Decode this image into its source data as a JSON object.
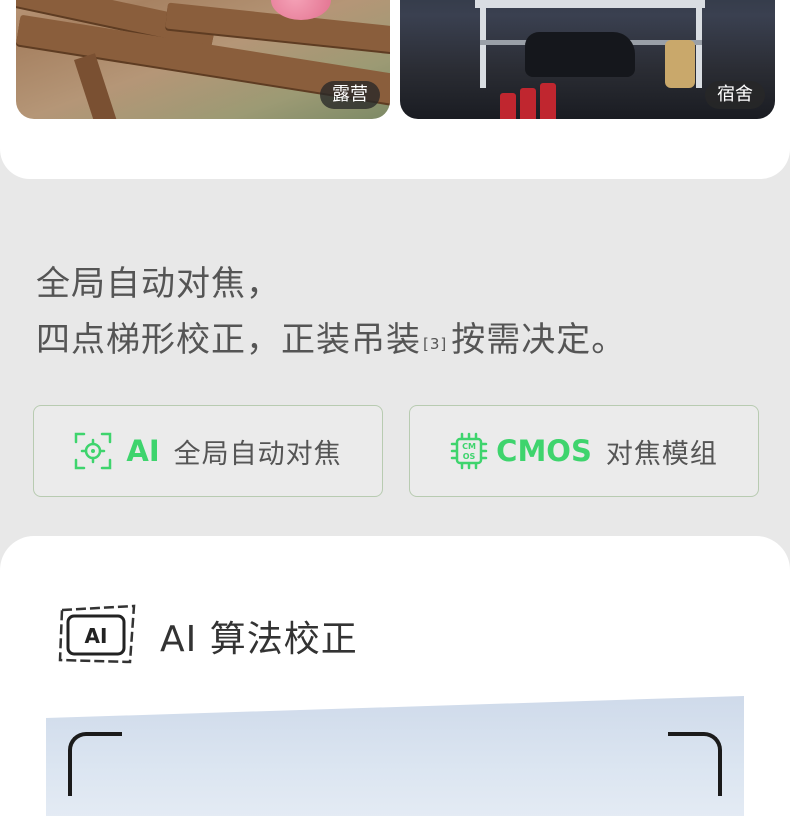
{
  "photos": [
    {
      "label": "露营",
      "icon": "camping-scene"
    },
    {
      "label": "宿舍",
      "icon": "dorm-scene"
    }
  ],
  "headline": {
    "line1": "全局自动对焦，",
    "line2_a": "四点梯形校正，正装吊装",
    "line2_sup": "[3]",
    "line2_b": "按需决定。"
  },
  "features": [
    {
      "icon": "focus-target-icon",
      "highlight": "AI",
      "text": "全局自动对焦"
    },
    {
      "icon": "cmos-chip-icon",
      "highlight": "CMOS",
      "text": "对焦模组",
      "chip_text_top": "CM",
      "chip_text_bottom": "OS"
    }
  ],
  "section": {
    "badge": "AI",
    "title": "AI 算法校正"
  },
  "colors": {
    "accent_green": "#3ed46d",
    "page_bg": "#e8e8e8",
    "text_gray": "#555555"
  }
}
